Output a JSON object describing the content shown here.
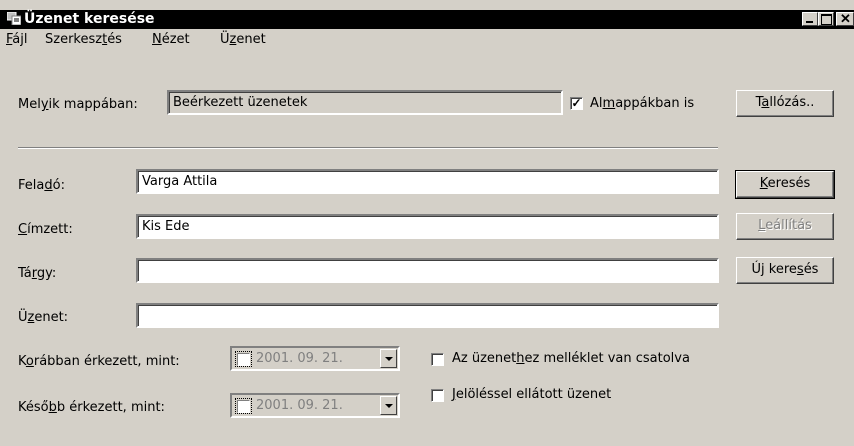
{
  "window": {
    "title": "Üzenet keresése",
    "buttons": [
      "minimize",
      "maximize",
      "close"
    ]
  },
  "menu": [
    {
      "pre": "",
      "key": "F",
      "post": "ájl"
    },
    {
      "pre": "Szerkesz",
      "key": "t",
      "post": "és"
    },
    {
      "pre": "",
      "key": "N",
      "post": "ézet"
    },
    {
      "pre": "Ü",
      "key": "z",
      "post": "enet"
    }
  ],
  "folder": {
    "label_pre": "Mel",
    "label_key": "y",
    "label_post": "ik mappában:",
    "value": "Beérkezett üzenetek",
    "subfolders_checked": true,
    "subfolders_pre": "Al",
    "subfolders_key": "m",
    "subfolders_post": "appákban is",
    "browse_pre": "T",
    "browse_key": "a",
    "browse_post": "llózás.."
  },
  "fields": {
    "sender_pre": "Fela",
    "sender_key": "d",
    "sender_post": "ó:",
    "sender_value": "Varga Attila",
    "recipient_pre": "",
    "recipient_key": "C",
    "recipient_post": "ímzett:",
    "recipient_value": "Kis Ede",
    "subject_pre": "Tá",
    "subject_key": "r",
    "subject_post": "gy:",
    "subject_value": "",
    "message_pre": "Ü",
    "message_key": "z",
    "message_post": "enet:",
    "message_value": ""
  },
  "buttons": {
    "search_pre": "",
    "search_key": "K",
    "search_post": "eresés",
    "stop_pre": "",
    "stop_key": "L",
    "stop_post": "eállítás",
    "new_pre": "Új kere",
    "new_key": "s",
    "new_post": "és"
  },
  "dates": {
    "before_pre": "K",
    "before_key": "o",
    "before_post": "rábban érkezett, mint:",
    "before_value": "2001. 09. 21.",
    "after_pre": "Késő",
    "after_key": "b",
    "after_post": "b érkezett, mint:",
    "after_value": "2001. 09. 21."
  },
  "options": {
    "attachment_pre": "Az üzenet",
    "attachment_key": "h",
    "attachment_post": "ez melléklet van csatolva",
    "attachment_checked": false,
    "flagged_pre": "",
    "flagged_key": "J",
    "flagged_post": "elöléssel ellátott üzenet",
    "flagged_checked": false
  },
  "colors": {
    "titlebar": "#000000",
    "face": "#d4d0c8",
    "disabled_text": "#808080"
  }
}
